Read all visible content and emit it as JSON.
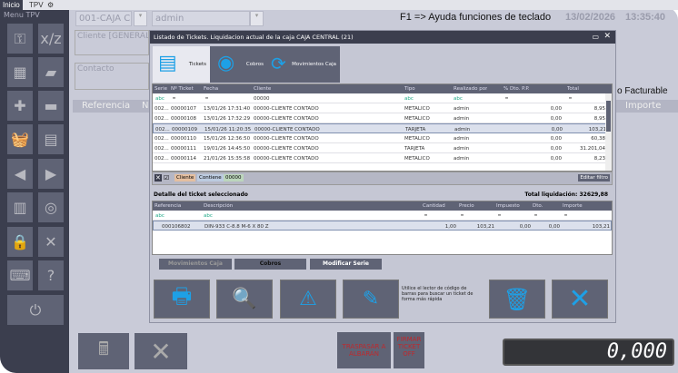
{
  "topbar": {
    "tabs": [
      "Inicio",
      "TPV"
    ],
    "gear_icon": "gear-icon"
  },
  "sidebar": {
    "title": "Menu TPV",
    "buttons": [
      "key-icon",
      "xz-report-icon",
      "boxes-icon",
      "book-icon",
      "plus-icon",
      "minus-icon",
      "basket-icon",
      "document-chart-icon",
      "arrow-left-icon",
      "arrow-right-icon",
      "report-icon",
      "coins-icon",
      "users-lock-icon",
      "tools-icon",
      "keyboard-icon",
      "help-icon"
    ],
    "power": "power-icon"
  },
  "header": {
    "caja": "001-CAJA CE...",
    "user": "admin",
    "help": "F1 => Ayuda funciones de teclado",
    "date": "13/02/2026",
    "time": "13:35:40"
  },
  "form": {
    "cliente_label": "Cliente [GENERAL]",
    "contacto_label": "Contacto",
    "facturable": "o Facturable",
    "col_referencia": "Referencia",
    "col_n": "N",
    "col_importe": "Importe"
  },
  "modal": {
    "title": "Listado de Tickets. Liquidacion actual de la caja CAJA CENTRAL (21)",
    "tabs": [
      {
        "label": "Tickets",
        "icon": "tickets-icon"
      },
      {
        "label": "Cobros",
        "icon": "coins-icon"
      },
      {
        "label": "Movimientos Caja",
        "icon": "refresh-icon"
      }
    ],
    "columns": [
      "Serie",
      "Nº Ticket",
      "Fecha",
      "Cliente",
      "Tipo",
      "Realizado por",
      "% Dto. P.P.",
      "Total"
    ],
    "filter": {
      "serie": "abc",
      "cliente": "00000",
      "tipo": "abc",
      "realizado": "abc"
    },
    "rows": [
      [
        "002...",
        "00000107",
        "13/01/26 17:31:40",
        "00000-CLIENTE CONTADO",
        "METALICO",
        "admin",
        "0,00",
        "8,95"
      ],
      [
        "002...",
        "00000108",
        "13/01/26 17:32:29",
        "00000-CLIENTE CONTADO",
        "METALICO",
        "admin",
        "0,00",
        "8,95"
      ],
      [
        "002...",
        "00000109",
        "15/01/26 11:20:35",
        "00000-CLIENTE CONTADO",
        "TARJETA",
        "admin",
        "0,00",
        "103,21"
      ],
      [
        "002...",
        "00000110",
        "15/01/26 12:36:50",
        "00000-CLIENTE CONTADO",
        "METALICO",
        "admin",
        "0,00",
        "60,38"
      ],
      [
        "002...",
        "00000111",
        "19/01/26 14:45:50",
        "00000-CLIENTE CONTADO",
        "TARJETA",
        "admin",
        "0,00",
        "31.201,04"
      ],
      [
        "002...",
        "00000114",
        "21/01/26 15:35:58",
        "00000-CLIENTE CONTADO",
        "METALICO",
        "admin",
        "0,00",
        "8,23"
      ]
    ],
    "filterbar": {
      "field": "Cliente",
      "op": "Contiene",
      "value": "00000",
      "edit": "Editar filtro"
    },
    "detail": {
      "label": "Detalle del ticket seleccionado",
      "total_label": "Total liquidación:",
      "total": "32629,88",
      "columns": [
        "Referencia",
        "Descripción",
        "Cantidad",
        "Precio",
        "Impuesto",
        "Dto.",
        "Importe"
      ],
      "rows": [
        [
          "000106802",
          "DIN-933 C-8.8 M-6 X 80 Z",
          "1,00",
          "103,21",
          "0,00",
          "0,00",
          "103,21"
        ]
      ]
    },
    "buttons": {
      "movimientos": "Movimientos Caja",
      "cobros": "Cobros",
      "modificar": "Modificar Serie"
    },
    "hint": "Utilice el lector de código de barras para buscar un ticket de forma más rápida"
  },
  "bottom": {
    "traspasar": "TRASPASAR A ALBARÁN",
    "firmar": "FIRMAR TICKET OFF",
    "display": "0,000"
  },
  "colors": {
    "dark": "#3b3e4e",
    "button": "#5f6375",
    "accent_blue": "#1ea0e6",
    "red_text": "#c0282c"
  }
}
